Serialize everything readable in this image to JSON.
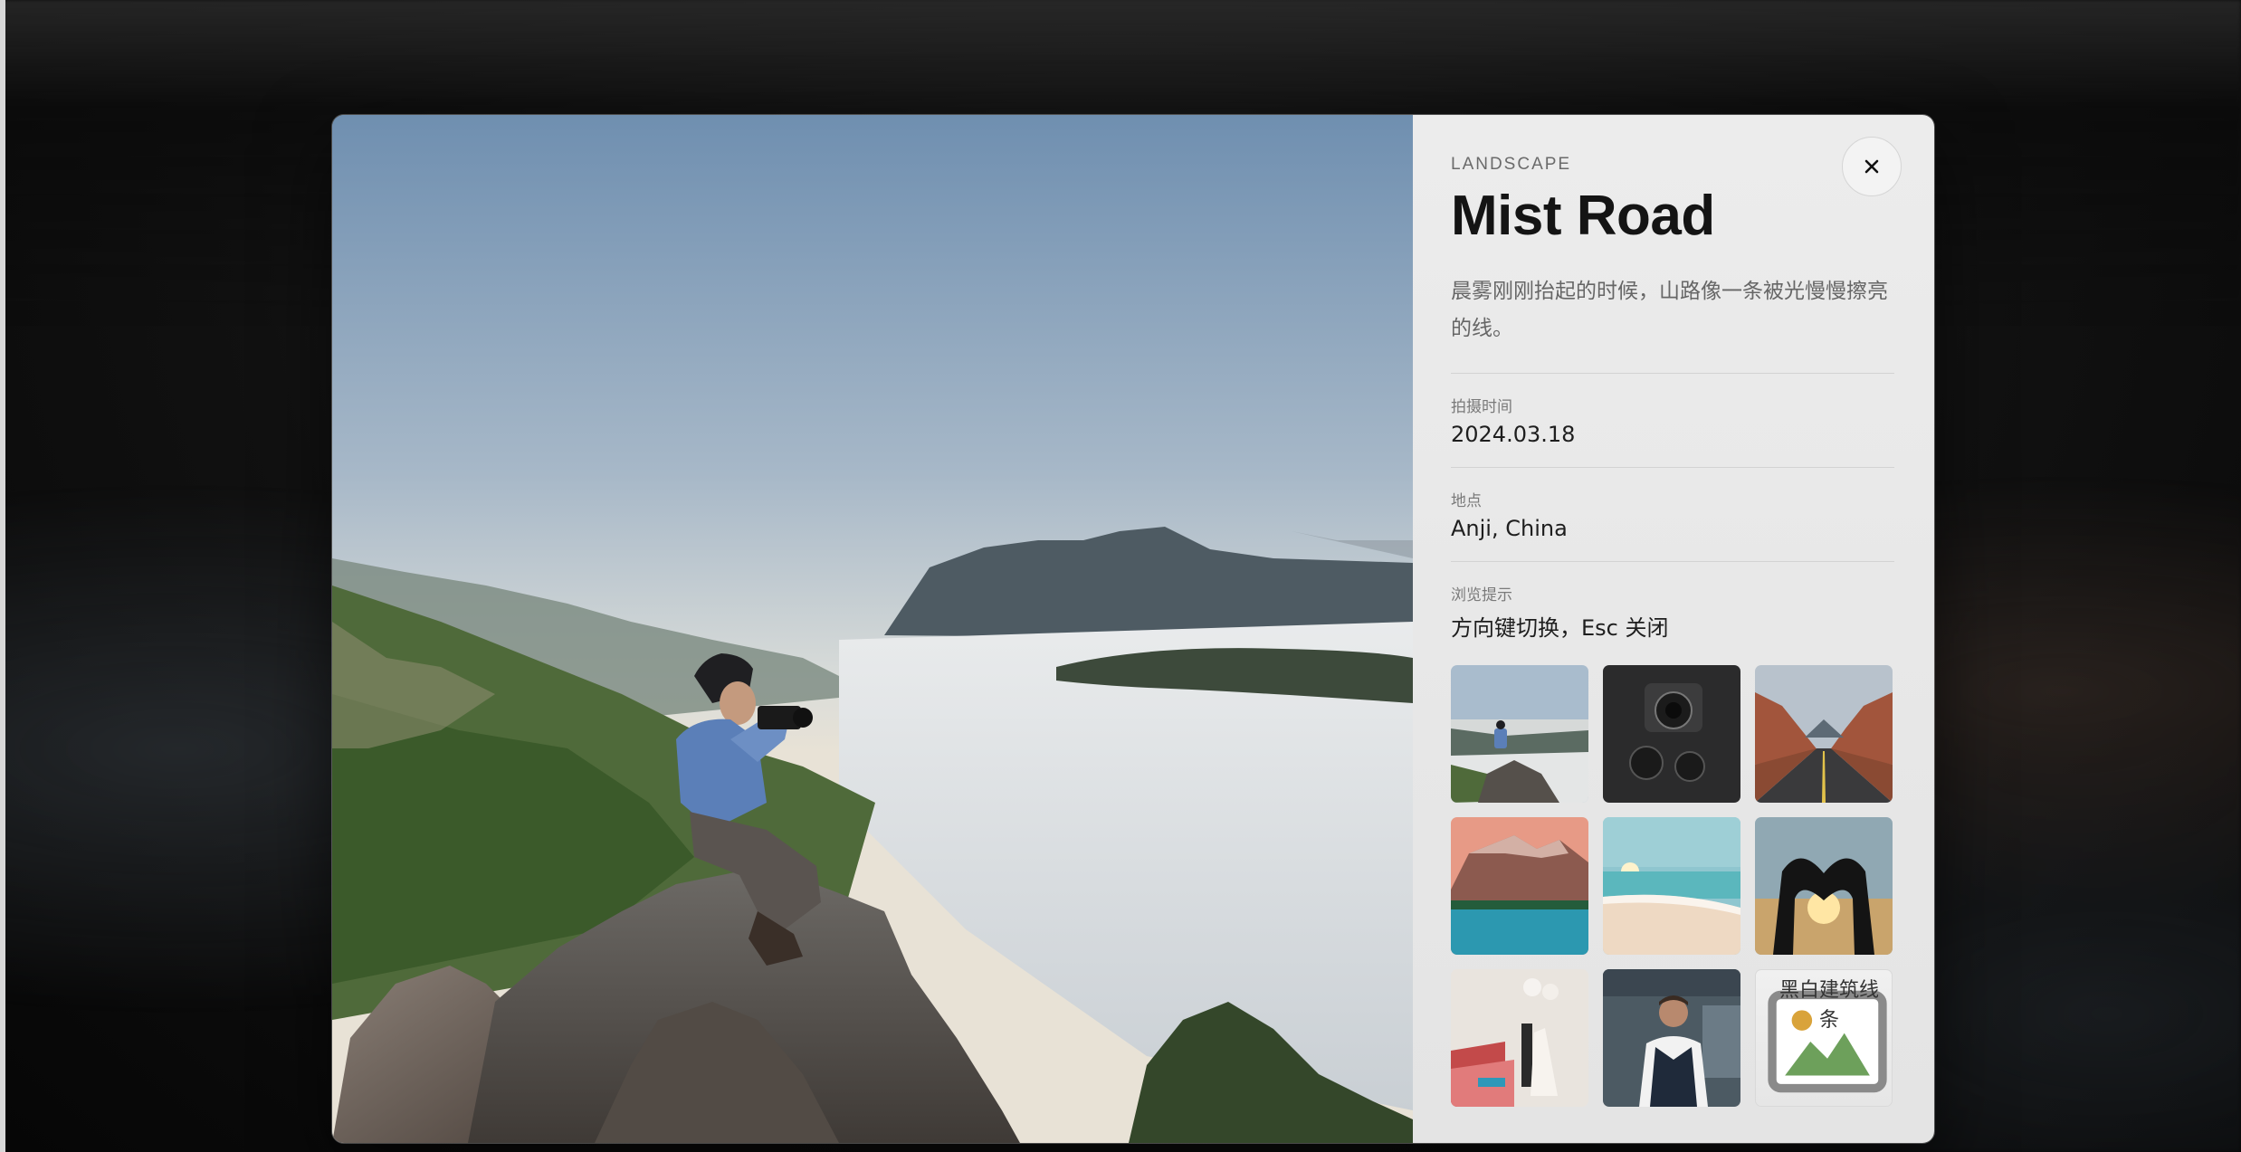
{
  "lightbox": {
    "category": "LANDSCAPE",
    "title": "Mist Road",
    "description": "晨雾刚刚抬起的时候，山路像一条被光慢慢擦亮的线。",
    "close_icon": "close-icon",
    "meta": [
      {
        "label": "拍摄时间",
        "value": "2024.03.18"
      },
      {
        "label": "地点",
        "value": "Anji, China"
      },
      {
        "label": "浏览提示",
        "value": "方向键切换，Esc 关闭"
      }
    ],
    "main_photo": "photographer-on-mountain-peak",
    "thumbnails": [
      {
        "subject": "photographer-on-mountain",
        "selected": true
      },
      {
        "subject": "camera-and-lenses"
      },
      {
        "subject": "desert-road"
      },
      {
        "subject": "mountain-lake"
      },
      {
        "subject": "beach-sunset"
      },
      {
        "subject": "heart-hands-sunset"
      },
      {
        "subject": "wedding-couple"
      },
      {
        "subject": "man-in-vest"
      },
      {
        "subject": "broken-image",
        "alt": "黑白建筑线条"
      }
    ]
  }
}
